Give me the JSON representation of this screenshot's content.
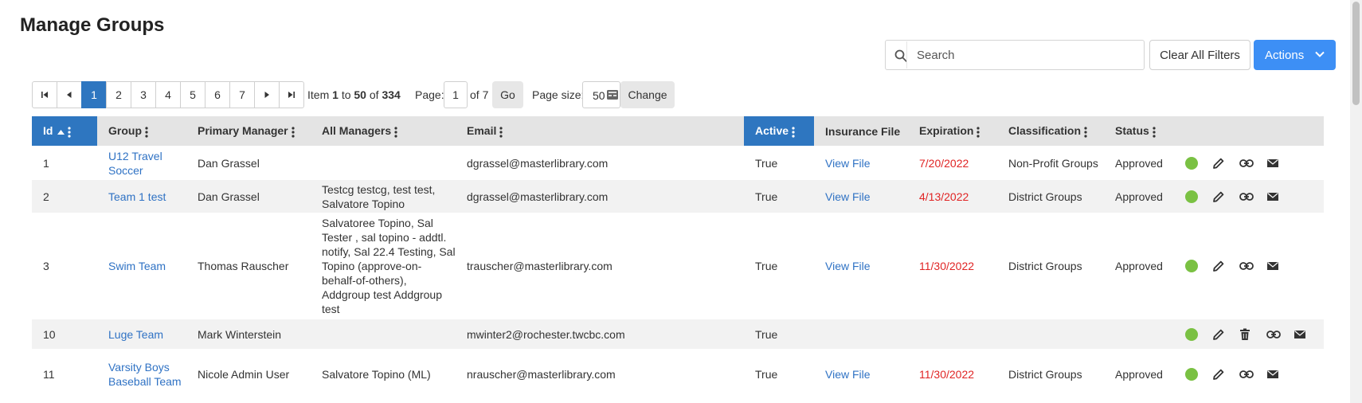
{
  "page": {
    "title": "Manage Groups"
  },
  "toolbar": {
    "search_placeholder": "Search",
    "clear_filters_label": "Clear All Filters",
    "actions_label": "Actions",
    "accent_color": "#3d8ff5"
  },
  "pager": {
    "pages": [
      "1",
      "2",
      "3",
      "4",
      "5",
      "6",
      "7"
    ],
    "current_page": "1",
    "item_label": "Item",
    "item_from": "1",
    "to_label": "to",
    "item_to": "50",
    "of_label": "of",
    "total": "334",
    "page_label": "Page:",
    "page_value": "1",
    "of_pages": "of 7",
    "go_label": "Go",
    "size_label": "Page size:",
    "size_value": "50",
    "change_label": "Change"
  },
  "table": {
    "columns": {
      "id": "Id",
      "group": "Group",
      "primary_manager": "Primary Manager",
      "all_managers": "All Managers",
      "email": "Email",
      "active": "Active",
      "insurance_file": "Insurance File",
      "expiration": "Expiration",
      "classification": "Classification",
      "status": "Status"
    },
    "rows": [
      {
        "id": "1",
        "group": "U12 Travel Soccer",
        "primary_manager": "Dan Grassel",
        "all_managers": "",
        "email": "dgrassel@masterlibrary.com",
        "active": "True",
        "insurance_file": "View File",
        "expiration": "7/20/2022",
        "classification": "Non-Profit Groups",
        "status": "Approved"
      },
      {
        "id": "2",
        "group": "Team 1 test",
        "primary_manager": "Dan Grassel",
        "all_managers": "Testcg testcg, test test, Salvatore Topino",
        "email": "dgrassel@masterlibrary.com",
        "active": "True",
        "insurance_file": "View File",
        "expiration": "4/13/2022",
        "classification": "District Groups",
        "status": "Approved"
      },
      {
        "id": "3",
        "group": "Swim Team",
        "primary_manager": "Thomas Rauscher",
        "all_managers": "Salvatoree Topino, Sal Tester , sal topino - addtl. notify, Sal 22.4 Testing, Sal Topino (approve-on-behalf-of-others), Addgroup test Addgroup test",
        "email": "trauscher@masterlibrary.com",
        "active": "True",
        "insurance_file": "View File",
        "expiration": "11/30/2022",
        "classification": "District Groups",
        "status": "Approved"
      },
      {
        "id": "10",
        "group": "Luge Team",
        "primary_manager": "Mark Winterstein",
        "all_managers": "",
        "email": "mwinter2@rochester.twcbc.com",
        "active": "True",
        "insurance_file": "",
        "expiration": "",
        "classification": "",
        "status": ""
      },
      {
        "id": "11",
        "group": "Varsity Boys Baseball Team",
        "primary_manager": "Nicole Admin User",
        "all_managers": "Salvatore Topino (ML)",
        "email": "nrauscher@masterlibrary.com",
        "active": "True",
        "insurance_file": "View File",
        "expiration": "11/30/2022",
        "classification": "District Groups",
        "status": "Approved"
      }
    ]
  },
  "colors": {
    "header_highlight": "#2e76c0",
    "link": "#2f72c4",
    "expiration": "#e02424",
    "active_dot": "#7ac143"
  },
  "icons": [
    "search-icon",
    "chevron-down-icon",
    "first-page-icon",
    "prev-page-icon",
    "next-page-icon",
    "last-page-icon",
    "page-size-icon",
    "sort-asc-icon",
    "column-menu-icon",
    "status-dot-icon",
    "edit-icon",
    "delete-icon",
    "link-icon",
    "email-icon"
  ]
}
